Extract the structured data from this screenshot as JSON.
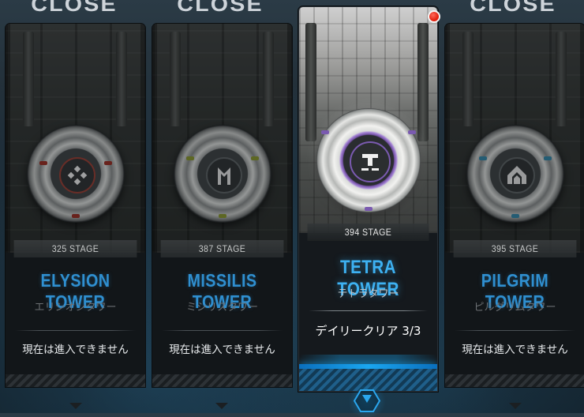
{
  "close_labels": [
    "CLOSE",
    "CLOSE",
    "CLOSE"
  ],
  "towers": [
    {
      "stage": "325 STAGE",
      "name": "ELYSION TOWER",
      "name_jp": "エリシオンタワー",
      "status": "現在は進入できません",
      "emblem_icon": "elysion-diamond-icon",
      "accent": "#c0392b",
      "active": false
    },
    {
      "stage": "387 STAGE",
      "name": "MISSILIS TOWER",
      "name_jp": "ミシリスタワー",
      "status": "現在は進入できません",
      "emblem_icon": "missilis-m-icon",
      "accent": "#9aa83a",
      "active": false
    },
    {
      "stage": "394 STAGE",
      "name": "TETRA TOWER",
      "name_jp": "テトラタワー",
      "status": "デイリークリア 3/3",
      "emblem_icon": "tetra-t-icon",
      "accent": "#7a5ab0",
      "active": true
    },
    {
      "stage": "395 STAGE",
      "name": "PILGRIM TOWER",
      "name_jp": "ピルグリムタワー",
      "status": "現在は進入できません",
      "emblem_icon": "pilgrim-arrow-icon",
      "accent": "#3a8fb0",
      "active": false
    }
  ],
  "colors": {
    "title_blue": "#2f8fd0",
    "active_title_blue": "#3db1f2",
    "notify_red": "#e3220f"
  }
}
